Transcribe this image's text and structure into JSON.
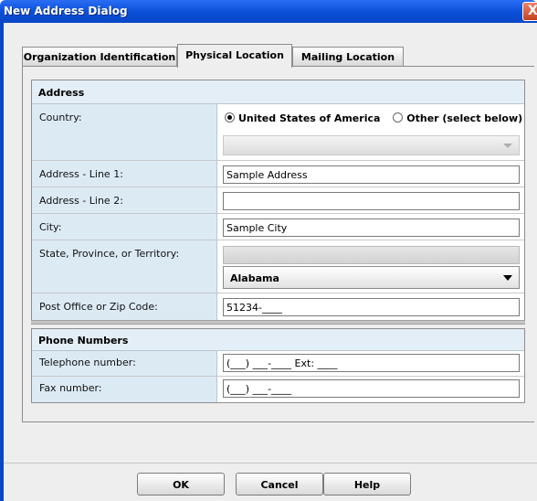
{
  "window": {
    "title": "New Address Dialog",
    "close_glyph": "X"
  },
  "tabs": [
    {
      "label": "Organization Identification",
      "active": false
    },
    {
      "label": "Physical Location",
      "active": true
    },
    {
      "label": "Mailing Location",
      "active": false
    }
  ],
  "address": {
    "header": "Address",
    "country_label": "Country:",
    "country_options": [
      "United States of America",
      "Other (select below)"
    ],
    "country_selected": "United States of America",
    "line1_label": "Address - Line 1:",
    "line1_value": "Sample Address",
    "line2_label": "Address - Line 2:",
    "line2_value": "",
    "city_label": "City:",
    "city_value": "Sample City",
    "state_label": "State, Province, or Territory:",
    "state_value": "Alabama",
    "zip_label": "Post Office or Zip Code:",
    "zip_value": "51234-____"
  },
  "phones": {
    "header": "Phone Numbers",
    "telephone_label": "Telephone number:",
    "telephone_value": "(___) ___-____ Ext: ____",
    "fax_label": "Fax number:",
    "fax_value": "(___) ___-____"
  },
  "buttons": {
    "ok": "OK",
    "cancel": "Cancel",
    "help": "Help"
  },
  "icons": {
    "close": "close-icon",
    "dropdown": "chevron-down-icon",
    "radio": "radio-icon"
  }
}
